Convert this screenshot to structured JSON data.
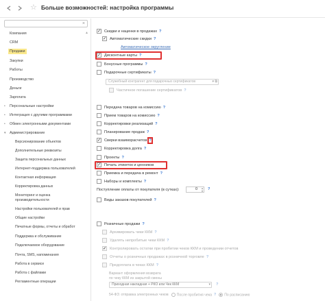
{
  "window": {
    "title": "Больше возможностей: настройка программы"
  },
  "sidebar": {
    "search_placeholder": "",
    "top_items": [
      {
        "label": "Компания"
      },
      {
        "label": "CRM"
      },
      {
        "label": "Продажи",
        "selected": true
      },
      {
        "label": "Закупки"
      },
      {
        "label": "Работы"
      },
      {
        "label": "Производство"
      },
      {
        "label": "Деньги"
      },
      {
        "label": "Зарплата"
      }
    ],
    "groups": [
      {
        "label": "Персональные настройки",
        "expanded": false
      },
      {
        "label": "Интеграция с другими программами",
        "expanded": false
      },
      {
        "label": "Обмен электронными документами",
        "expanded": false
      },
      {
        "label": "Администрирование",
        "expanded": true
      }
    ],
    "admin_items": [
      {
        "label": "Версионирование объектов"
      },
      {
        "label": "Дополнительные реквизиты"
      },
      {
        "label": "Защита персональных данных"
      },
      {
        "label": "Интернет-поддержка пользователей"
      },
      {
        "label": "Контактная информация"
      },
      {
        "label": "Корректировка данных"
      },
      {
        "label": "Мониторинг и оценка"
      },
      {
        "label": "производительности"
      },
      {
        "label": "Настройки пользователей и прав"
      },
      {
        "label": "Общие настройки"
      },
      {
        "label": "Печатные формы, отчеты и обработ"
      },
      {
        "label": "Поддержка и обслуживание"
      },
      {
        "label": "Подключаемое оборудование"
      },
      {
        "label": "Почта, SMS, напоминания"
      },
      {
        "label": "Работа в сервисе"
      },
      {
        "label": "Работа с файлами"
      },
      {
        "label": "Регламентные операции"
      }
    ]
  },
  "settings": {
    "discounts": {
      "label": "Скидки и наценки в продажах",
      "checked": true
    },
    "auto_discounts": {
      "label": "Автоматические скидки",
      "checked": true
    },
    "auto_rounding": {
      "label": "Автоматическое округление"
    },
    "discount_cards": {
      "label": "Дисконтные карты",
      "checked": true
    },
    "bonus_programs": {
      "label": "Бонусные программы",
      "checked": false
    },
    "gift_certificates": {
      "label": "Подарочные сертификаты",
      "checked": false
    },
    "service_counterparty": {
      "placeholder": "Служебный контрагент для подарочных сертификатов"
    },
    "partial_redemption": {
      "label": "Частичное погашение сертификатов",
      "checked": false
    },
    "commission_sale": {
      "label": "Передача товаров на комиссию",
      "checked": false
    },
    "commission_accept": {
      "label": "Прием товаров на комиссию",
      "checked": false
    },
    "realization_adjust": {
      "label": "Корректировки реализаций",
      "checked": false
    },
    "sales_planning": {
      "label": "Планирование продаж",
      "checked": false
    },
    "reconciliation": {
      "label": "Сверки взаиморасчетов",
      "checked": true
    },
    "debt_adjust": {
      "label": "Корректировка долга",
      "checked": false
    },
    "projects": {
      "label": "Проекты",
      "checked": false
    },
    "label_printing": {
      "label": "Печать этикеток и ценников",
      "checked": true
    },
    "repair": {
      "label": "Приемка и передача в ремонт",
      "checked": false
    },
    "kits": {
      "label": "Наборы и комплекты",
      "checked": false
    },
    "payment_days": {
      "label": "Поступление оплаты от покупателя (в сутках):",
      "value": "0"
    },
    "buyer_orders": {
      "label": "Виды заказов покупателей",
      "checked": false
    },
    "retail": {
      "label": "Розничные продажи",
      "checked": false
    },
    "retail_sub": [
      {
        "label": "Архивировать чеки ККМ"
      },
      {
        "label": "Удалять непробитые чеки ККМ"
      },
      {
        "label": "Контролировать остатки при пробитии чеков ККМ и проведении отчетов"
      },
      {
        "label": "Отчеты о розничных продажах в розничной торговле"
      },
      {
        "label": "Предоплата в чеках ККМ"
      }
    ],
    "return_option": {
      "label1": "Вариант оформления возврата",
      "label2": "по чеку ККМ из закрытой смены",
      "value": "Приходная накладная + РКО или Чек ККМ"
    },
    "fz54": {
      "label": "54-ФЗ: отправка электронных чеков",
      "opt1": "После пробития чека",
      "opt2": "По расписанию"
    }
  }
}
